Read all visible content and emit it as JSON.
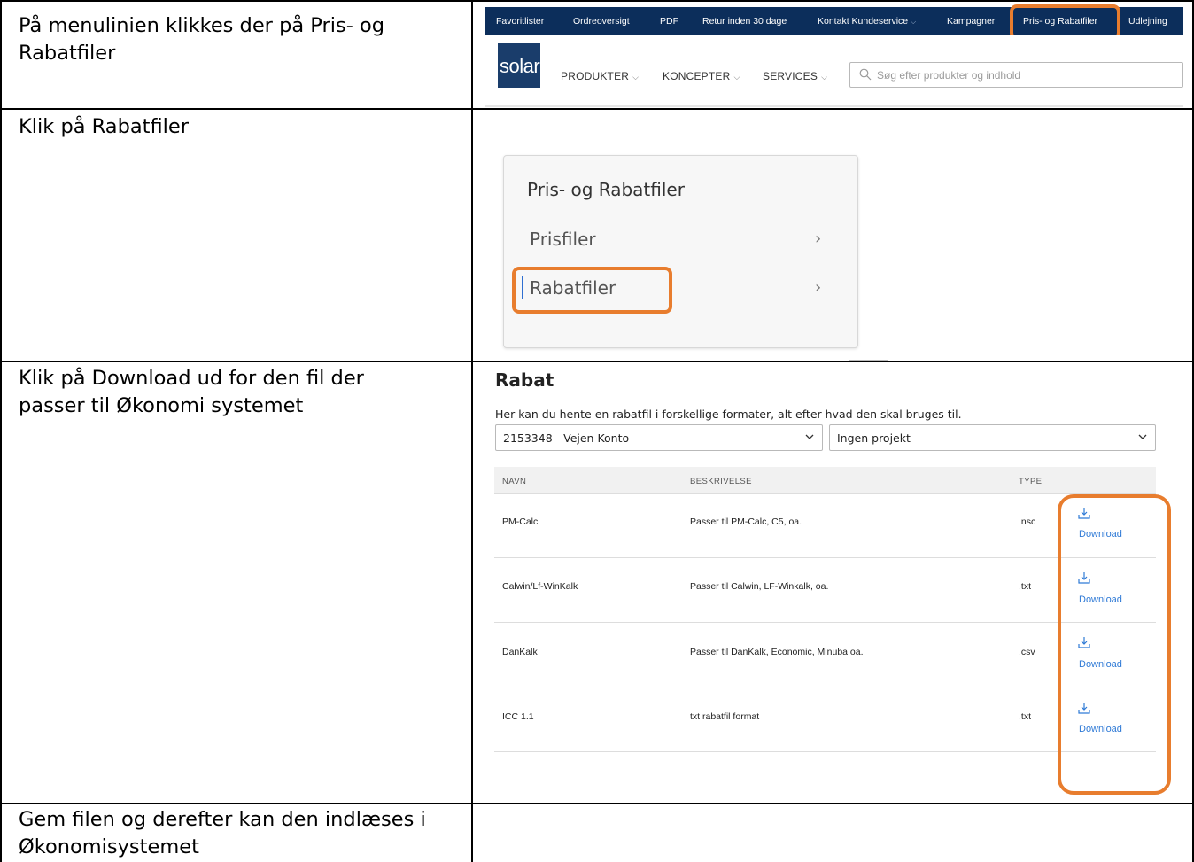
{
  "steps": [
    {
      "text_line1": "På menulinien klikkes der på Pris- og",
      "text_line2": "Rabatfiler"
    },
    {
      "text_line1": "Klik på Rabatfiler"
    },
    {
      "text_line1": "Klik på Download ud for den fil der",
      "text_line2": "passer til Økonomi systemet"
    },
    {
      "text_line1": "Gem filen og derefter kan den indlæses i",
      "text_line2": "Økonomisystemet"
    }
  ],
  "header_screenshot": {
    "top_nav": [
      "Favoritlister",
      "Ordreoversigt",
      "PDF",
      "Retur inden 30 dage",
      "Kontakt Kundeservice",
      "Kampagner",
      "Pris- og Rabatfiler",
      "Udlejning"
    ],
    "logo": "solar",
    "main_nav": [
      "PRODUKTER",
      "KONCEPTER",
      "SERVICES"
    ],
    "search_placeholder": "Søg efter produkter og indhold",
    "nav_bg_color": "#0c2e5b",
    "highlight_color": "#e87d2e"
  },
  "menu_screenshot": {
    "title": "Pris- og Rabatfiler",
    "items": [
      "Prisfiler",
      "Rabatfiler"
    ],
    "chevron": "›"
  },
  "rabat_screenshot": {
    "title": "Rabat",
    "description": "Her kan du hente en rabatfil i forskellige formater, alt efter hvad den skal bruges til.",
    "account_select": "2153348 - Vejen Konto",
    "project_select": "Ingen projekt",
    "columns": [
      "NAVN",
      "BESKRIVELSE",
      "TYPE"
    ],
    "rows": [
      {
        "name": "PM-Calc",
        "description": "Passer til PM-Calc, C5, oa.",
        "type": ".nsc",
        "action": "Download"
      },
      {
        "name": "Calwin/Lf-WinKalk",
        "description": "Passer til Calwin, LF-Winkalk, oa.",
        "type": ".txt",
        "action": "Download"
      },
      {
        "name": "DanKalk",
        "description": "Passer til DanKalk, Economic, Minuba oa.",
        "type": ".csv",
        "action": "Download"
      },
      {
        "name": "ICC 1.1",
        "description": "txt rabatfil format",
        "type": ".txt",
        "action": "Download"
      }
    ]
  }
}
